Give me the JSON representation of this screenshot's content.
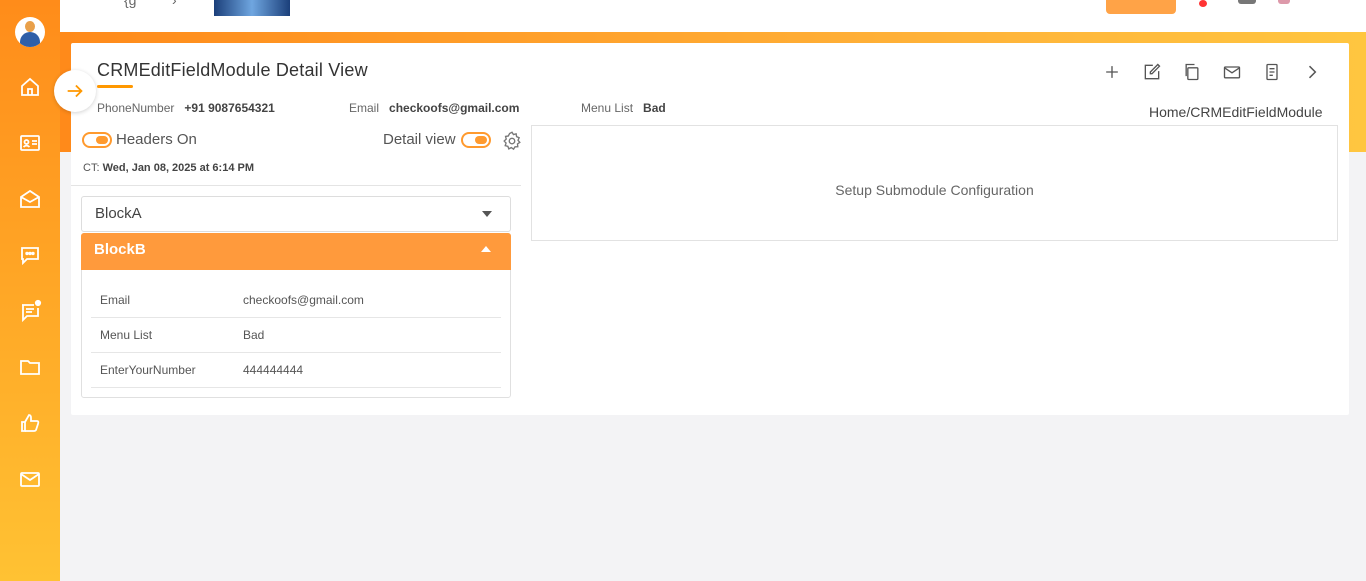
{
  "sidebar": {
    "items": [
      {
        "icon": "home-icon"
      },
      {
        "icon": "contact-card-icon"
      },
      {
        "icon": "mail-open-icon"
      },
      {
        "icon": "chat-icon"
      },
      {
        "icon": "notification-message-icon"
      },
      {
        "icon": "folder-icon"
      },
      {
        "icon": "thumbs-up-icon"
      },
      {
        "icon": "mail-icon"
      }
    ]
  },
  "header": {
    "title": "CRMEditFieldModule Detail View",
    "breadcrumb": "Home/CRMEditFieldModule"
  },
  "info": {
    "phone_label": "PhoneNumber",
    "phone_value": "+91 9087654321",
    "email_label": "Email",
    "email_value": "checkoofs@gmail.com",
    "menu_label": "Menu List",
    "menu_value": "Bad"
  },
  "toggles": {
    "headers_label": "Headers On",
    "detail_label": "Detail view"
  },
  "created": {
    "prefix": "CT:",
    "value": "Wed, Jan 08, 2025 at 6:14 PM"
  },
  "blocks": {
    "a_name": "BlockA",
    "b_name": "BlockB",
    "b_rows": [
      {
        "key": "Email",
        "value": "checkoofs@gmail.com"
      },
      {
        "key": "Menu List",
        "value": "Bad"
      },
      {
        "key": "EnterYourNumber",
        "value": "444444444"
      }
    ]
  },
  "submodule": {
    "text": "Setup Submodule Configuration"
  },
  "colors": {
    "accent": "#ff9a2e",
    "sidebar_top": "#ff8c1a",
    "sidebar_bottom": "#ffc233"
  }
}
